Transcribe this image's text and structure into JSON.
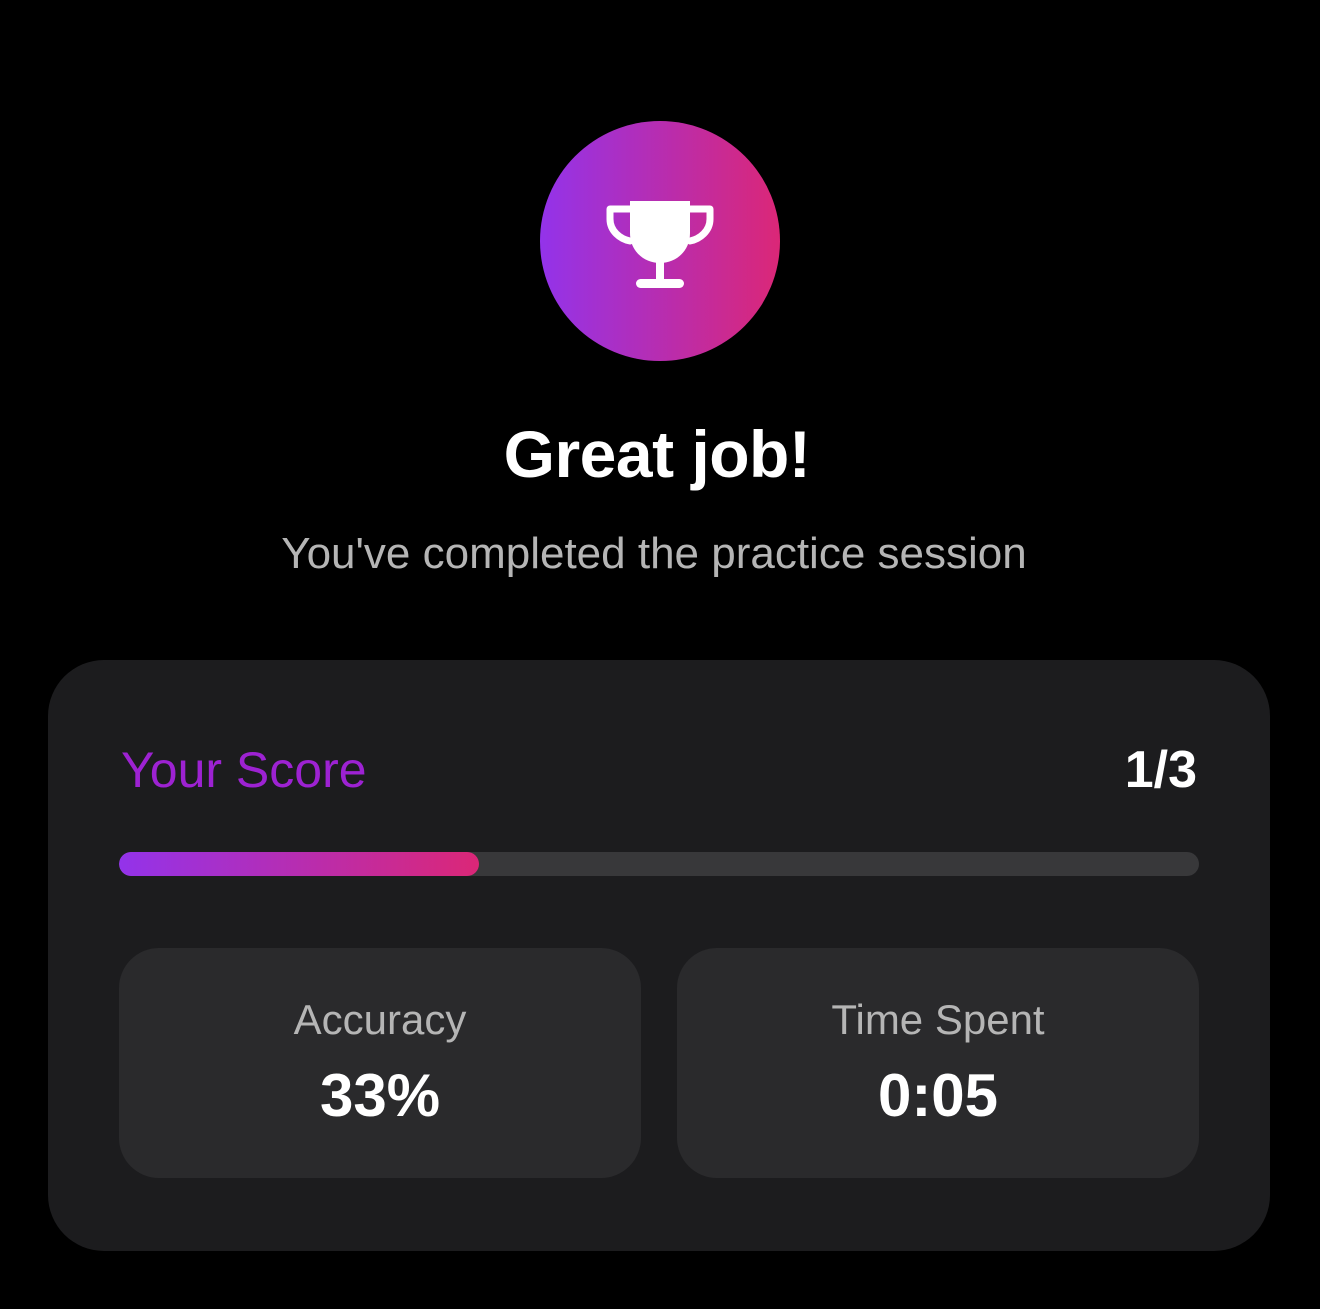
{
  "header": {
    "icon": "trophy-icon",
    "title": "Great job!",
    "subtitle": "You've completed the practice session"
  },
  "score": {
    "label": "Your Score",
    "value": "1/3",
    "progress_fraction": 0.333
  },
  "stats": {
    "accuracy": {
      "label": "Accuracy",
      "value": "33%"
    },
    "time_spent": {
      "label": "Time Spent",
      "value": "0:05"
    }
  },
  "colors": {
    "background": "#000000",
    "card": "#1c1c1e",
    "stat_card": "#2a2a2c",
    "gradient_start": "#9333ea",
    "gradient_end": "#db2777",
    "score_label": "#9d22d2",
    "muted_text": "#b5b5b5"
  }
}
